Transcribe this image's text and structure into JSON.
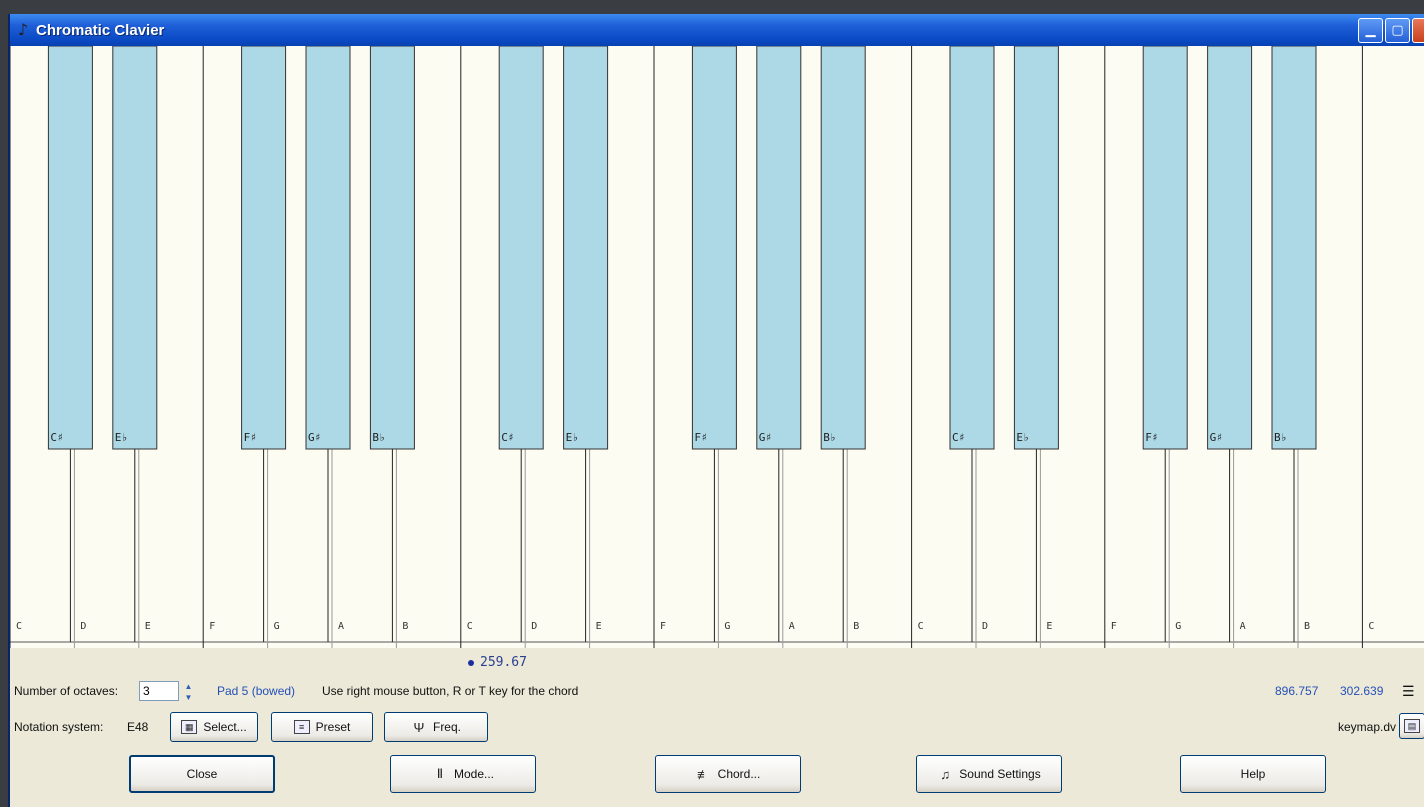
{
  "window": {
    "title": "Chromatic Clavier"
  },
  "piano": {
    "white_keys": [
      "C",
      "D",
      "E",
      "F",
      "G",
      "A",
      "B",
      "C",
      "D",
      "E",
      "F",
      "G",
      "A",
      "B",
      "C",
      "D",
      "E",
      "F",
      "G",
      "A",
      "B",
      "C"
    ],
    "black_keys": [
      "C♯",
      "E♭",
      "F♯",
      "G♯",
      "B♭",
      "C♯",
      "E♭",
      "F♯",
      "G♯",
      "B♭",
      "C♯",
      "E♭",
      "F♯",
      "G♯",
      "B♭"
    ]
  },
  "frequency_readout": "259.67",
  "controls": {
    "octaves_label": "Number of octaves:",
    "octaves_value": "3",
    "instrument": "Pad 5 (bowed)",
    "hint": "Use right mouse button, R or T key for the chord",
    "coord_x": "896.757",
    "coord_y": "302.639",
    "notation_label": "Notation system:",
    "notation_value": "E48",
    "select_label": "Select...",
    "preset_label": "Preset",
    "freq_label": "Freq.",
    "keymap_label": "keymap.dv"
  },
  "buttons": {
    "close": "Close",
    "mode": "Mode...",
    "chord": "Chord...",
    "sound_settings": "Sound Settings",
    "help": "Help"
  },
  "colors": {
    "black_key_fill": "#add8e6",
    "white_key_fill": "#fdfcf2",
    "title_bar": "#0a4ac4"
  },
  "icons": {
    "app": "note-icon",
    "select": "grid-icon",
    "preset": "list-icon",
    "freq": "tuning-fork-icon",
    "mode": "mode-icon",
    "chord": "chord-icon",
    "sound": "sound-icon"
  }
}
